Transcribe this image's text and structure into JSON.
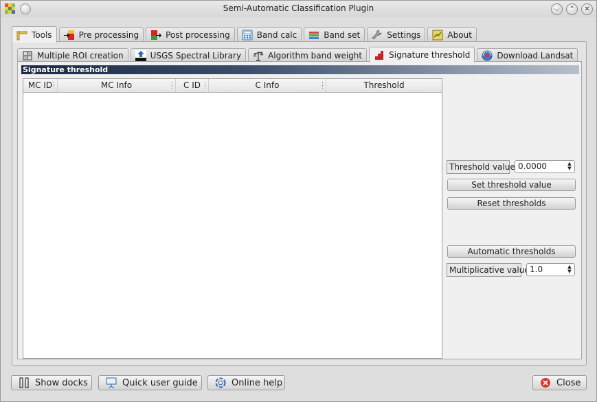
{
  "window": {
    "title": "Semi-Automatic Classification Plugin"
  },
  "tabs": [
    {
      "label": "Tools",
      "icon": "pencil-ruler-icon"
    },
    {
      "label": "Pre processing",
      "icon": "pre-processing-icon"
    },
    {
      "label": "Post processing",
      "icon": "post-processing-icon"
    },
    {
      "label": "Band calc",
      "icon": "calculator-icon"
    },
    {
      "label": "Band set",
      "icon": "band-set-icon"
    },
    {
      "label": "Settings",
      "icon": "wrench-icon"
    },
    {
      "label": "About",
      "icon": "about-icon"
    }
  ],
  "subtabs": [
    {
      "label": "Multiple ROI creation",
      "icon": "multiple-roi-icon"
    },
    {
      "label": "USGS Spectral Library",
      "icon": "usgs-icon"
    },
    {
      "label": "Algorithm band weight",
      "icon": "scale-icon"
    },
    {
      "label": "Signature threshold",
      "icon": "signature-threshold-icon"
    },
    {
      "label": "Download Landsat",
      "icon": "landsat-download-icon"
    }
  ],
  "section": {
    "title": "Signature threshold"
  },
  "table": {
    "columns": [
      "MC ID",
      "MC Info",
      "C ID",
      "C Info",
      "Threshold"
    ],
    "rows": []
  },
  "controls": {
    "threshold_label": "Threshold value",
    "threshold_value": "0.0000",
    "set_threshold_button": "Set threshold value",
    "reset_thresholds_button": "Reset thresholds",
    "automatic_thresholds_button": "Automatic thresholds",
    "multiplicative_label": "Multiplicative value",
    "multiplicative_value": "1.0"
  },
  "footer": {
    "show_docks": "Show docks",
    "quick_user_guide": "Quick user guide",
    "online_help": "Online help",
    "close": "Close"
  },
  "colors": {
    "header_gradient_start": "#1d2a40",
    "header_gradient_end": "#b6bfcc",
    "close_icon": "#d83a2a"
  }
}
